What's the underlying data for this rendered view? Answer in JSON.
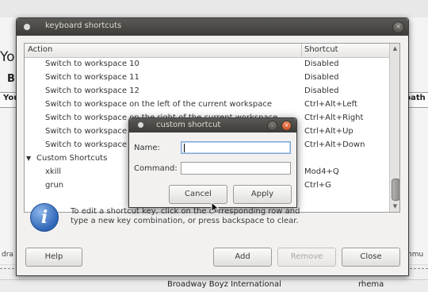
{
  "background": {
    "heading_fragment": "Yo",
    "sub_fragment": "B",
    "col_left_fragment": "You",
    "col_right_fragment": "path",
    "left_fragment": "dra",
    "right_fragment": "mmu",
    "row_cell_1": "Broadway Boyz International",
    "row_cell_2": "rhema"
  },
  "window": {
    "title": "keyboard shortcuts",
    "columns": {
      "action": "Action",
      "shortcut": "Shortcut"
    },
    "rows": [
      {
        "action": "Switch to workspace 10",
        "shortcut": "Disabled",
        "kind": "item"
      },
      {
        "action": "Switch to workspace 11",
        "shortcut": "Disabled",
        "kind": "item"
      },
      {
        "action": "Switch to workspace 12",
        "shortcut": "Disabled",
        "kind": "item"
      },
      {
        "action": "Switch to workspace on the left of the current workspace",
        "shortcut": "Ctrl+Alt+Left",
        "kind": "item"
      },
      {
        "action": "Switch to workspace on the right of the current workspace",
        "shortcut": "Ctrl+Alt+Right",
        "kind": "item"
      },
      {
        "action": "Switch to workspace above the current workspace",
        "shortcut": "Ctrl+Alt+Up",
        "kind": "item"
      },
      {
        "action": "Switch to workspace below the current workspace",
        "shortcut": "Ctrl+Alt+Down",
        "kind": "item"
      },
      {
        "action": "Custom Shortcuts",
        "shortcut": "",
        "kind": "group"
      },
      {
        "action": "xkill",
        "shortcut": "Mod4+Q",
        "kind": "item"
      },
      {
        "action": "grun",
        "shortcut": "Ctrl+G",
        "kind": "item"
      }
    ],
    "info_text": "To edit a shortcut key, click on the corresponding row and type a new key combination, or press backspace to clear.",
    "buttons": {
      "help": "Help",
      "add": "Add",
      "remove": "Remove",
      "close": "Close"
    }
  },
  "dialog": {
    "title": "custom shortcut",
    "name_label": "Name:",
    "name_value": "",
    "command_label": "Command:",
    "command_value": "",
    "cancel": "Cancel",
    "apply": "Apply"
  }
}
